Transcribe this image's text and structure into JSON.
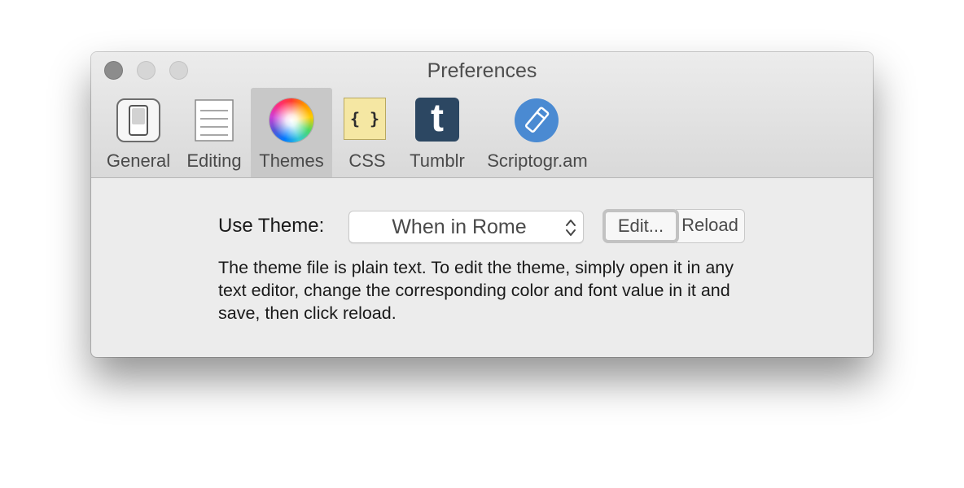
{
  "window": {
    "title": "Preferences"
  },
  "toolbar": {
    "tabs": [
      {
        "label": "General",
        "icon": "switch-icon",
        "selected": false
      },
      {
        "label": "Editing",
        "icon": "document-lines-icon",
        "selected": false
      },
      {
        "label": "Themes",
        "icon": "color-wheel-icon",
        "selected": true
      },
      {
        "label": "CSS",
        "icon": "css-braces-icon",
        "selected": false,
        "icon_text": "{ }"
      },
      {
        "label": "Tumblr",
        "icon": "tumblr-icon",
        "selected": false,
        "icon_text": "t"
      },
      {
        "label": "Scriptogr.am",
        "icon": "scriptogram-icon",
        "selected": false
      }
    ]
  },
  "themes": {
    "use_theme_label": "Use Theme:",
    "selected_theme": "When in Rome",
    "edit_button": "Edit...",
    "reload_button": "Reload",
    "description": "The theme file is plain text. To edit the theme, simply open it in any text editor, change the corresponding color and font value in it and save, then click reload."
  },
  "colors": {
    "window_bg": "#ececec",
    "selected_tab_bg": "#c8c8c8",
    "tumblr": "#2c4762",
    "scriptogram": "#4a8ad2",
    "css_icon_bg": "#f5e7a3"
  }
}
